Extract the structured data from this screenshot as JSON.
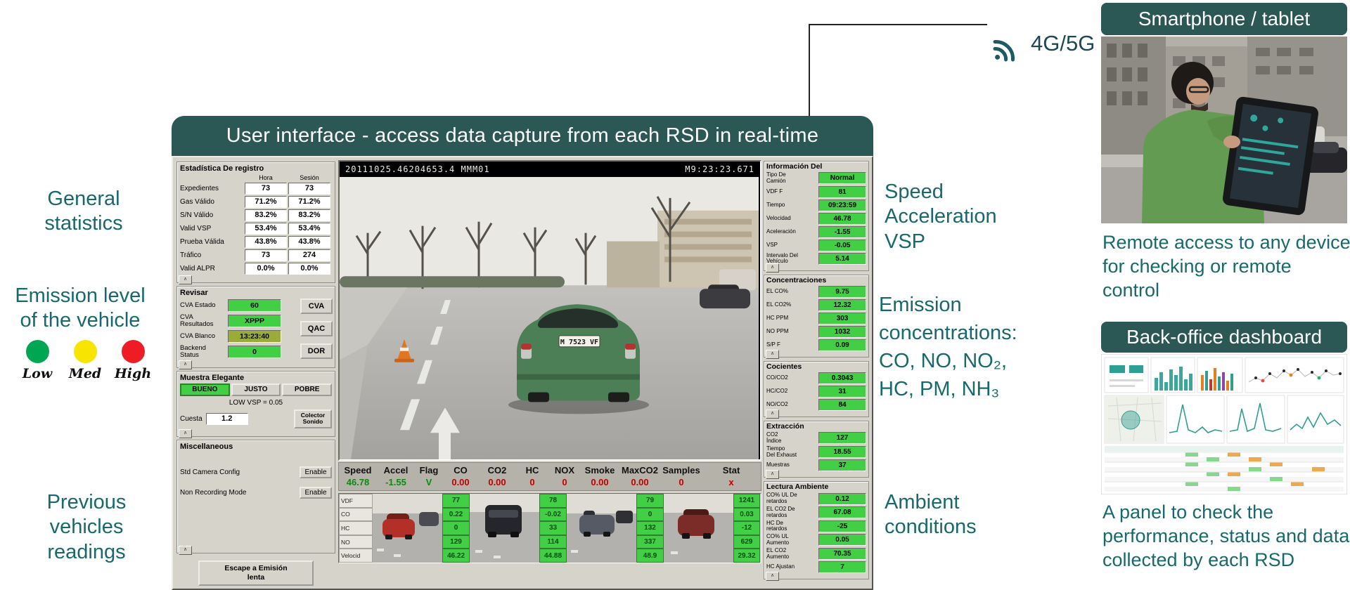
{
  "colors": {
    "teal_header": "#2b5755",
    "teal_text": "#17696c",
    "green_box": "#42cf45",
    "olive_box": "#9aab39",
    "value_green": "#0b8a0f",
    "value_red": "#c00000"
  },
  "left_annotations": {
    "general_statistics": "General\nstatistics",
    "emission_level": "Emission level\nof the vehicle",
    "levels": [
      {
        "label": "Low",
        "color": "#00a651"
      },
      {
        "label": "Med",
        "color": "#f7e400"
      },
      {
        "label": "High",
        "color": "#ee1c25"
      }
    ],
    "previous_vehicles": "Previous\nvehicles\nreadings"
  },
  "right_annotations": {
    "speed_block": "Speed\nAcceleration\nVSP",
    "emissions_block": "Emission\nconcentrations:\nCO, NO, NO₂,\nHC, PM, NH₃",
    "ambient_block": "Ambient\nconditions",
    "network": "4G/5G"
  },
  "smartphone": {
    "title": "Smartphone / tablet",
    "caption": "Remote access to any device\nfor checking or remote\ncontrol"
  },
  "dashboard": {
    "title": "Back-office dashboard",
    "caption": "A panel to check the\nperformance, status and data\ncollected by each RSD"
  },
  "window": {
    "title": "User interface - access data capture from each RSD in real-time",
    "left_panel": {
      "stats": {
        "title": "Estadística De registro",
        "col_headers": [
          "Hora",
          "Sesión"
        ],
        "rows": [
          {
            "label": "Expedientes",
            "v1": "73",
            "v2": "73"
          },
          {
            "label": "Gas Válido",
            "v1": "71.2%",
            "v2": "71.2%"
          },
          {
            "label": "S/N Válido",
            "v1": "83.2%",
            "v2": "83.2%"
          },
          {
            "label": "Valid VSP",
            "v1": "53.4%",
            "v2": "53.4%"
          },
          {
            "label": "Prueba Válida",
            "v1": "43.8%",
            "v2": "43.8%"
          },
          {
            "label": "Tráfico",
            "v1": "73",
            "v2": "274"
          },
          {
            "label": "Valid ALPR",
            "v1": "0.0%",
            "v2": "0.0%"
          }
        ]
      },
      "revisar": {
        "title": "Revisar",
        "rows": [
          {
            "label": "CVA Estado",
            "value": "60",
            "bg": "#42cf45"
          },
          {
            "label": "CVA\nResultados",
            "value": "XPPP",
            "bg": "#42cf45"
          },
          {
            "label": "CVA Blanco",
            "value": "13:23:40",
            "bg": "#9aab39"
          },
          {
            "label": "Backend Status",
            "value": "0",
            "bg": "#42cf45"
          }
        ],
        "buttons": [
          "CVA",
          "QAC",
          "DOR"
        ]
      },
      "muestra": {
        "title": "Muestra Elegante",
        "buttons": [
          "BUENO",
          "JUSTO",
          "POBRE"
        ],
        "low_vsp": "LOW VSP =  0.05",
        "cuesta_label": "Cuesta",
        "cuesta_value": "1.2",
        "collector_button": "Colector\nSonido"
      },
      "misc": {
        "title": "Miscellaneous",
        "rows": [
          {
            "label": "Std Camera Config",
            "button": "Enable"
          },
          {
            "label": "Non Recording Mode",
            "button": "Enable"
          }
        ]
      },
      "bottom_button": "Escape a Emisión\nlenta"
    },
    "video": {
      "timestamp_left": "20111025.46204653.4   MMM01",
      "timestamp_right": "M9:23:23.671",
      "plate": "M 7523 VF"
    },
    "table": {
      "cols": [
        {
          "h": "Speed",
          "v": "46.78",
          "c": "#0b8a0f"
        },
        {
          "h": "Accel",
          "v": "-1.55",
          "c": "#0b8a0f"
        },
        {
          "h": "Flag",
          "v": "V",
          "c": "#0b8a0f"
        },
        {
          "h": "CO",
          "v": "0.00",
          "c": "#c00000"
        },
        {
          "h": "CO2",
          "v": "0.00",
          "c": "#c00000"
        },
        {
          "h": "HC",
          "v": "0",
          "c": "#c00000"
        },
        {
          "h": "NOX",
          "v": "0",
          "c": "#c00000"
        },
        {
          "h": "Smoke",
          "v": "0.00",
          "c": "#c00000"
        },
        {
          "h": "MaxCO2",
          "v": "0.00",
          "c": "#c00000"
        },
        {
          "h": "Samples",
          "v": "0",
          "c": "#c00000"
        },
        {
          "h": "Stat",
          "v": "x",
          "c": "#c00000"
        }
      ]
    },
    "strip": {
      "row_labels": [
        "VDF",
        "CO",
        "HC",
        "NO",
        "Velocid"
      ],
      "columns": [
        [
          "77",
          "0.22",
          "0",
          "129",
          "46.22"
        ],
        [
          "78",
          "-0.02",
          "33",
          "114",
          "44.88"
        ],
        [
          "79",
          "0",
          "132",
          "337",
          "48.9"
        ],
        [
          "1241",
          "0.03",
          "-12",
          "629",
          "29.32"
        ]
      ]
    },
    "right_panel": {
      "sections": [
        {
          "title": "Información Del",
          "rows": [
            [
              "Tipo De\nCamión",
              "Normal"
            ],
            [
              "VDF F",
              "81"
            ],
            [
              "Tiempo",
              "09:23:59"
            ],
            [
              "Velocidad",
              "46.78"
            ],
            [
              "Aceleración",
              "-1.55"
            ],
            [
              "VSP",
              "-0.05"
            ],
            [
              "Intervalo Del\nVehículo",
              "5.14"
            ]
          ]
        },
        {
          "title": "Concentraciones",
          "rows": [
            [
              "EL CO%",
              "9.75"
            ],
            [
              "EL CO2%",
              "12.32"
            ],
            [
              "HC PPM",
              "303"
            ],
            [
              "NO PPM",
              "1032"
            ],
            [
              "S/P F",
              "0.09"
            ]
          ]
        },
        {
          "title": "Cocientes",
          "rows": [
            [
              "CO/CO2",
              "0.3043"
            ],
            [
              "HC/CO2",
              "31"
            ],
            [
              "NO/CO2",
              "84"
            ]
          ]
        },
        {
          "title": "Extracción",
          "rows": [
            [
              "CO2\nÍndice",
              "127"
            ],
            [
              "Tiempo\nDel Exhaust",
              "18.55"
            ],
            [
              "Muestras",
              "37"
            ]
          ]
        },
        {
          "title": "Lectura Ambiente",
          "rows": [
            [
              "CO% UL De\nretardos",
              "0.12"
            ],
            [
              "EL CO2 De\nretardos",
              "67.08"
            ],
            [
              "HC De\nretardos",
              "-25"
            ],
            [
              "CO% UL\nAumento",
              "0.05"
            ],
            [
              "EL CO2\nAumento",
              "70.35"
            ],
            [
              "HC Ajustan",
              "7"
            ]
          ]
        }
      ]
    }
  }
}
